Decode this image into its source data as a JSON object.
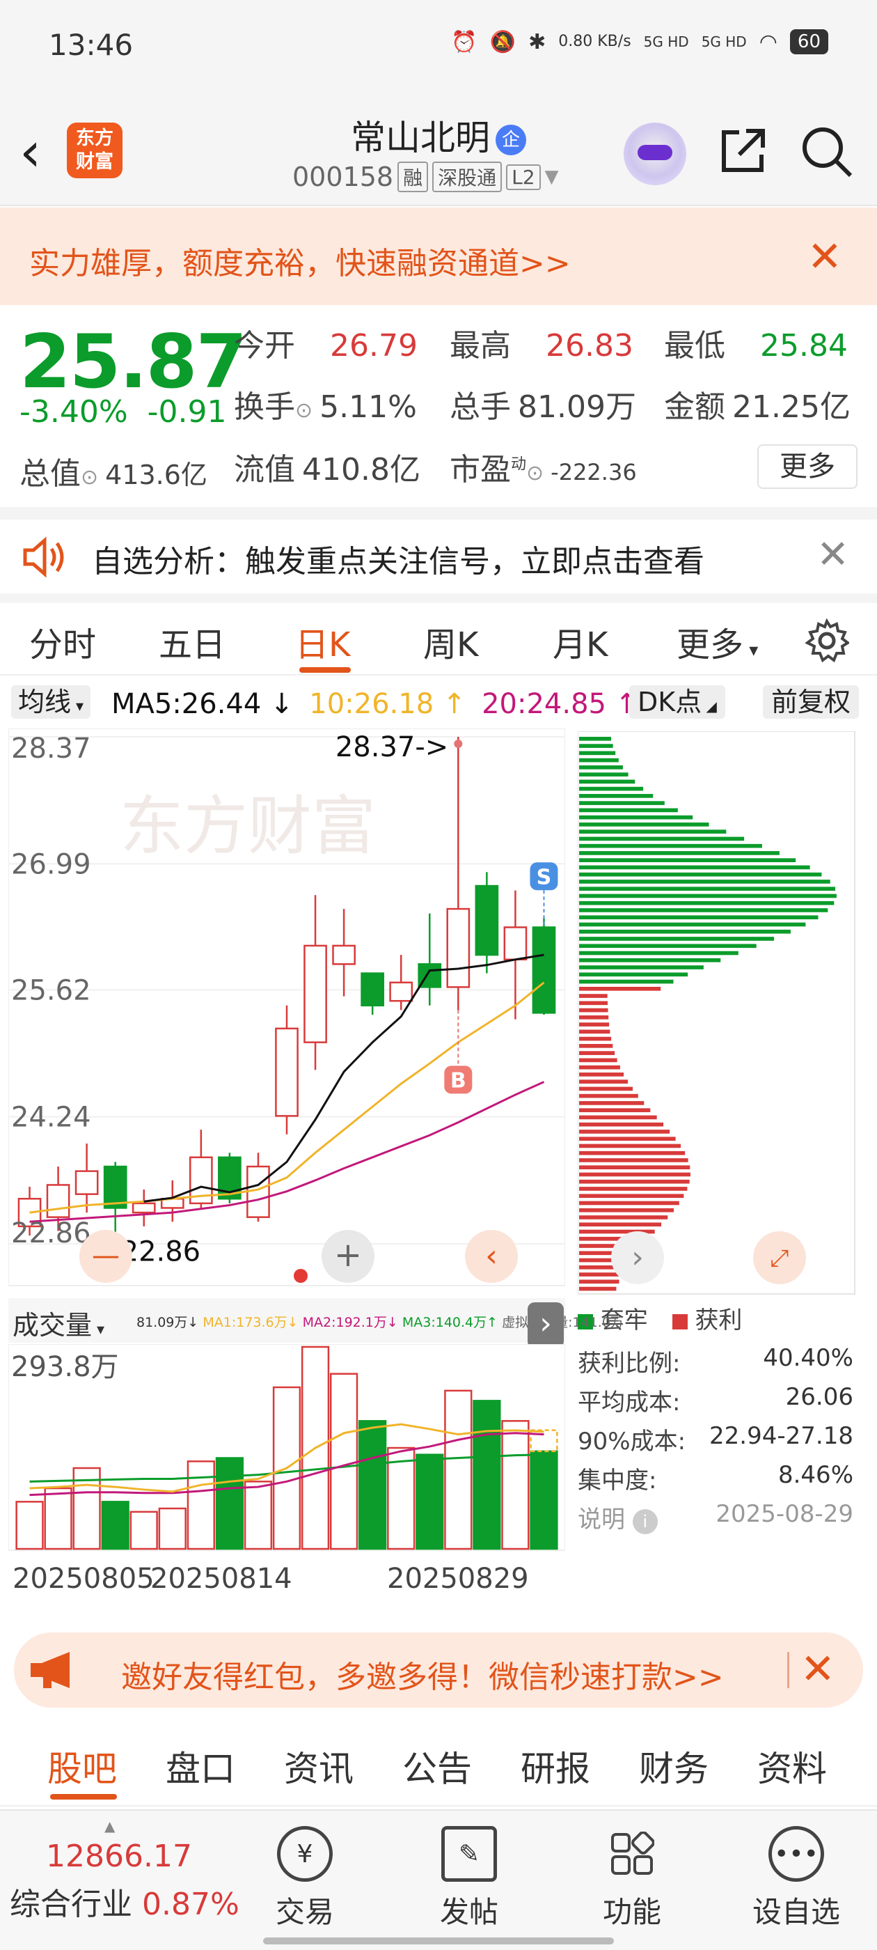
{
  "status_bar": {
    "time": "13:46",
    "net_speed": "0.80 KB/s",
    "signal1": "5G HD",
    "signal2": "5G HD",
    "battery": "60"
  },
  "header": {
    "title": "常山北明",
    "badge": "企",
    "code": "000158",
    "tags": [
      "融",
      "深股通",
      "L2"
    ]
  },
  "promo_top": {
    "text": "实力雄厚，额度充裕，快速融资通道>>"
  },
  "quote": {
    "price": "25.87",
    "change_pct": "-3.40%",
    "change_amt": "-0.91",
    "open_label": "今开",
    "open": "26.79",
    "high_label": "最高",
    "high": "26.83",
    "low_label": "最低",
    "low": "25.84",
    "turnover_label": "换手",
    "turnover": "5.11%",
    "volume_label": "总手",
    "volume": "81.09万",
    "amount_label": "金额",
    "amount": "21.25亿",
    "mktcap_label": "总值",
    "mktcap": "413.6亿",
    "float_label": "流值",
    "float": "410.8亿",
    "pe_label": "市盈",
    "pe_sup": "动",
    "pe": "-222.36",
    "more": "更多"
  },
  "signal_bar": {
    "text": "自选分析：触发重点关注信号，立即点击查看"
  },
  "chart_tabs": [
    "分时",
    "五日",
    "日K",
    "周K",
    "月K",
    "更多"
  ],
  "ma_bar": {
    "selector": "均线",
    "ma5": "MA5:26.44 ↓",
    "ma10": "10:26.18 ↑",
    "ma20": "20:24.85 ↑",
    "dk": "DK点",
    "adjust": "前复权"
  },
  "colors": {
    "up": "#d83a3a",
    "down": "#0b9c2b",
    "ma5": "#111111",
    "ma10": "#f0b429",
    "ma20": "#c2187a",
    "accent": "#e2541a"
  },
  "chart_data": [
    {
      "type": "candlestick",
      "y_ticks": [
        "28.37",
        "26.99",
        "25.62",
        "24.24",
        "22.86"
      ],
      "ylim": [
        22.86,
        28.37
      ],
      "high_marker": "28.37->",
      "low_marker": "<-22.86",
      "markers": [
        "S",
        "B"
      ],
      "candles": [
        {
          "o": 23.05,
          "c": 23.35,
          "h": 23.48,
          "l": 22.95
        },
        {
          "o": 23.15,
          "c": 23.5,
          "h": 23.7,
          "l": 23.0
        },
        {
          "o": 23.4,
          "c": 23.65,
          "h": 23.95,
          "l": 23.2
        },
        {
          "o": 23.7,
          "c": 23.25,
          "h": 23.75,
          "l": 22.9
        },
        {
          "o": 23.2,
          "c": 23.3,
          "h": 23.45,
          "l": 23.05
        },
        {
          "o": 23.25,
          "c": 23.35,
          "h": 23.55,
          "l": 23.1
        },
        {
          "o": 23.3,
          "c": 23.8,
          "h": 24.1,
          "l": 23.25
        },
        {
          "o": 23.8,
          "c": 23.35,
          "h": 23.85,
          "l": 23.3
        },
        {
          "o": 23.15,
          "c": 23.7,
          "h": 23.85,
          "l": 23.1
        },
        {
          "o": 24.25,
          "c": 25.2,
          "h": 25.45,
          "l": 24.05
        },
        {
          "o": 25.05,
          "c": 26.1,
          "h": 26.65,
          "l": 24.75
        },
        {
          "o": 25.9,
          "c": 26.1,
          "h": 26.5,
          "l": 25.55
        },
        {
          "o": 25.8,
          "c": 25.45,
          "h": 25.8,
          "l": 25.35
        },
        {
          "o": 25.5,
          "c": 25.7,
          "h": 26.0,
          "l": 25.4
        },
        {
          "o": 25.9,
          "c": 25.65,
          "h": 26.45,
          "l": 25.45
        },
        {
          "o": 25.65,
          "c": 26.5,
          "h": 28.37,
          "l": 25.4
        },
        {
          "o": 26.75,
          "c": 26.0,
          "h": 26.9,
          "l": 25.8
        },
        {
          "o": 25.95,
          "c": 26.3,
          "h": 26.7,
          "l": 25.3
        },
        {
          "o": 26.3,
          "c": 25.37,
          "h": 26.4,
          "l": 25.35
        }
      ],
      "ma5": [
        null,
        null,
        null,
        null,
        23.32,
        23.36,
        23.48,
        23.42,
        23.5,
        23.75,
        24.21,
        24.73,
        25.05,
        25.33,
        25.83,
        25.85,
        25.89,
        25.95,
        26.0
      ],
      "ma10": [
        23.2,
        23.24,
        23.28,
        23.3,
        23.32,
        23.35,
        23.38,
        23.4,
        23.45,
        23.58,
        23.85,
        24.1,
        24.35,
        24.6,
        24.82,
        25.05,
        25.25,
        25.45,
        25.7
      ],
      "ma20": [
        23.1,
        23.12,
        23.14,
        23.16,
        23.18,
        23.2,
        23.24,
        23.28,
        23.34,
        23.43,
        23.55,
        23.68,
        23.8,
        23.92,
        24.04,
        24.18,
        24.33,
        24.48,
        24.62
      ]
    },
    {
      "type": "volume",
      "header_value": "81.09万↓",
      "ma_labels": [
        "MA1:173.6万↓",
        "MA2:192.1万↓",
        "MA3:140.4万↑"
      ],
      "virtual": "虚拟成交量:141.0万",
      "y_max_label": "293.8万",
      "ylim": [
        0,
        293.8
      ],
      "bars": [
        70,
        90,
        120,
        70,
        55,
        60,
        130,
        135,
        100,
        240,
        300,
        260,
        190,
        150,
        140,
        235,
        220,
        190,
        145
      ],
      "ma1": [
        90,
        92,
        95,
        92,
        88,
        85,
        95,
        100,
        104,
        120,
        150,
        172,
        180,
        185,
        178,
        170,
        175,
        176,
        174
      ],
      "ma2": [
        80,
        82,
        84,
        84,
        83,
        83,
        86,
        90,
        92,
        100,
        112,
        124,
        135,
        145,
        152,
        162,
        170,
        172,
        170
      ],
      "ma3": [
        100,
        101,
        102,
        103,
        104,
        104,
        106,
        108,
        110,
        114,
        118,
        122,
        126,
        130,
        133,
        135,
        137,
        139,
        140
      ],
      "x_labels": [
        "20250805",
        "20250814",
        "20250829"
      ]
    }
  ],
  "volume_selector": "成交量",
  "chips": {
    "legend_trapped": "套牢",
    "legend_profit": "获利",
    "profit_ratio_label": "获利比例:",
    "profit_ratio": "40.40%",
    "avg_cost_label": "平均成本:",
    "avg_cost": "26.06",
    "cost90_label": "90%成本:",
    "cost90": "22.94-27.18",
    "concentration_label": "集中度:",
    "concentration": "8.46%",
    "note_label": "说明",
    "date": "2025-08-29"
  },
  "promo_bottom": {
    "text": "邀好友得红包，多邀多得！微信秒速打款>>"
  },
  "sub_tabs": [
    "股吧",
    "盘口",
    "资讯",
    "公告",
    "研报",
    "财务",
    "资料"
  ],
  "bottom_nav": {
    "index_value": "12866.17",
    "index_label": "综合行业",
    "index_change": "0.87%",
    "items": [
      "交易",
      "发帖",
      "功能",
      "设自选"
    ]
  }
}
